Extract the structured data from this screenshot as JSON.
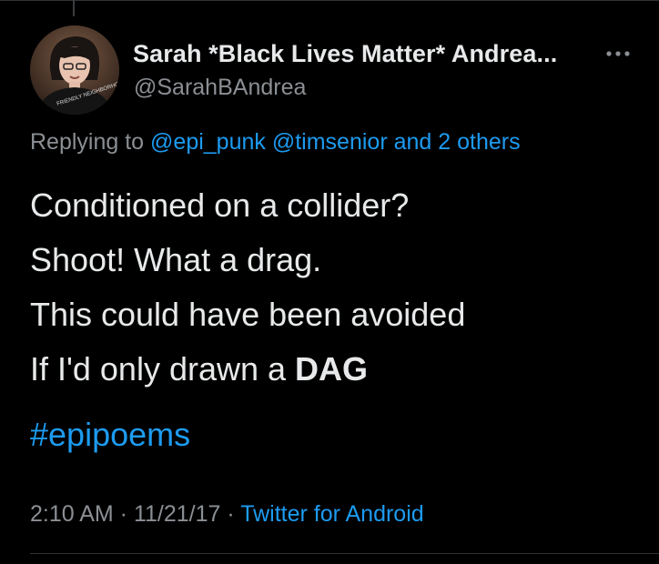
{
  "author": {
    "display_name": "Sarah *Black Lives Matter* Andrea...",
    "handle": "@SarahBAndrea",
    "avatar_shirt_text": "FRIENDLY NEIGHBORHOOD EPIDEMIOLOGIST"
  },
  "reply_context": {
    "prefix": "Replying to",
    "mention_1": "@epi_punk",
    "mention_2": "@timsenior",
    "suffix": "and 2 others"
  },
  "tweet": {
    "line_1": "Conditioned on a collider?",
    "line_2": "Shoot! What a drag.",
    "line_3": "This could have been avoided",
    "line_4_prefix": "If I'd only drawn a ",
    "line_4_bold": "DAG",
    "hashtag": "#epipoems"
  },
  "meta": {
    "time": "2:10 AM",
    "separator_1": " · ",
    "date": "11/21/17",
    "separator_2": " · ",
    "source": "Twitter for Android"
  },
  "icons": {
    "more": "more-horizontal-icon"
  },
  "colors": {
    "background": "#000000",
    "text": "#e7e9ea",
    "secondary_text": "#8b8f94",
    "link": "#1d9bf0",
    "divider": "#2f3336"
  }
}
